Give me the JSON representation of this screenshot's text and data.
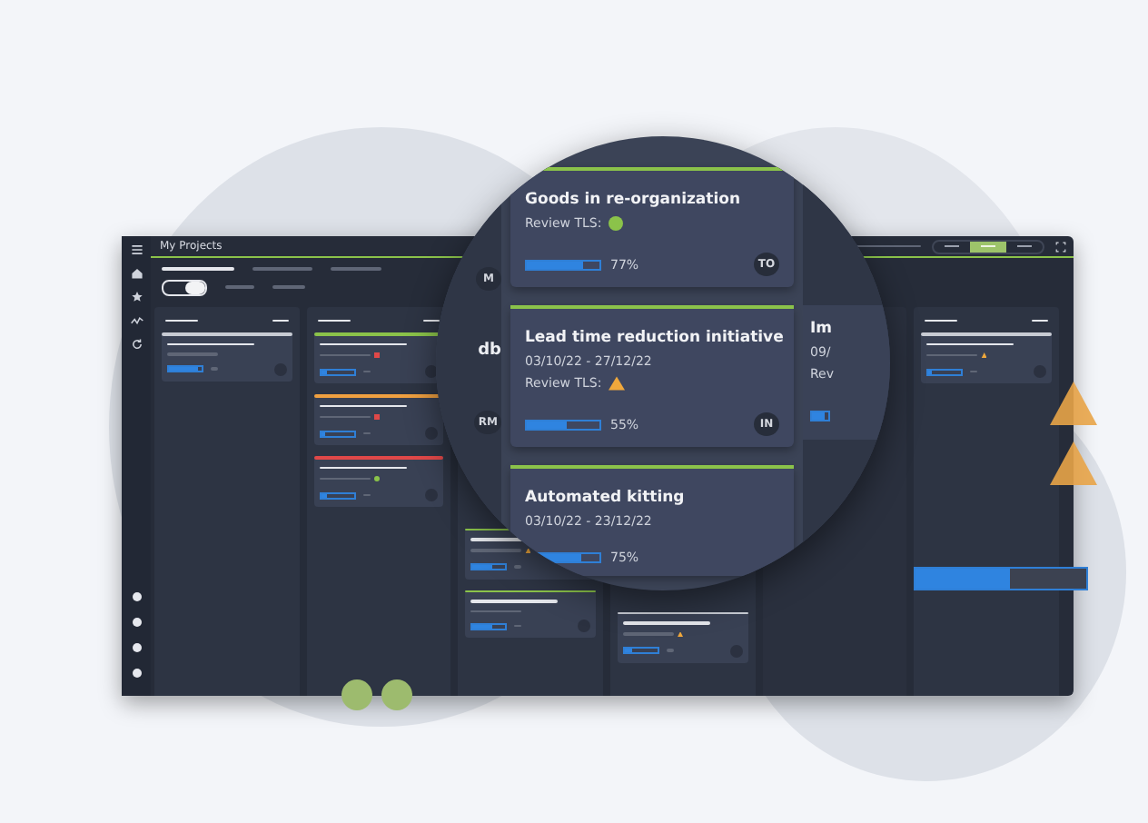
{
  "window": {
    "title": "My Projects"
  },
  "toolbar": {
    "toggle_on": true,
    "segments": [
      {
        "selected": false
      },
      {
        "selected": true
      },
      {
        "selected": false
      }
    ]
  },
  "columns": [
    {
      "kind": "open",
      "cards": [
        {
          "color": "#c8ccd4",
          "kind": "plain",
          "level": 0.9
        }
      ]
    },
    {
      "kind": "open",
      "cards": [
        {
          "color": "#8bc34a",
          "kind": "alert",
          "level": 0.2
        },
        {
          "color": "#f0a040",
          "kind": "alert",
          "level": 0.15
        },
        {
          "color": "#e04848",
          "kind": "ok",
          "level": 0.2
        }
      ]
    },
    {
      "kind": "covered",
      "cards": [
        {
          "color": "#8bc34a",
          "kind": "warning",
          "level": 0.6
        },
        {
          "color": "#8bc34a",
          "kind": "plain",
          "level": 0.6
        }
      ]
    },
    {
      "kind": "covered-deep",
      "cards": [
        {
          "color": "#c8ccd4",
          "kind": "warning",
          "level": 0.2
        }
      ]
    },
    {
      "kind": "hidden"
    },
    {
      "kind": "open",
      "cards": [
        {
          "color": "#c8ccd4",
          "kind": "warning",
          "level": 0.1
        }
      ]
    }
  ],
  "magnifier": {
    "left_fragments": [
      {
        "kind": "badge",
        "text": "M"
      },
      {
        "kind": "title",
        "text": "db"
      },
      {
        "kind": "badge",
        "text": "RM"
      }
    ],
    "cards": [
      {
        "title": "Goods in re-organization",
        "review": "Review TLS:",
        "kind": "ok",
        "level": 0.77,
        "progress": "77%",
        "badge": "TO",
        "color": "#8bc34a"
      },
      {
        "title": "Lead time reduction initiative",
        "dates": "03/10/22 - 27/12/22",
        "review": "Review TLS:",
        "kind": "warning",
        "level": 0.55,
        "progress": "55%",
        "badge": "IN",
        "color": "#8bc34a"
      },
      {
        "title": "Automated kitting",
        "dates": "03/10/22 - 23/12/22",
        "level": 0.75,
        "progress": "75%",
        "color": "#8bc34a"
      }
    ],
    "right_fragment": {
      "title": "Im",
      "dates": "09/",
      "review": "Rev",
      "level": 0.8
    }
  },
  "highlight_bar": {
    "level": 0.55
  }
}
